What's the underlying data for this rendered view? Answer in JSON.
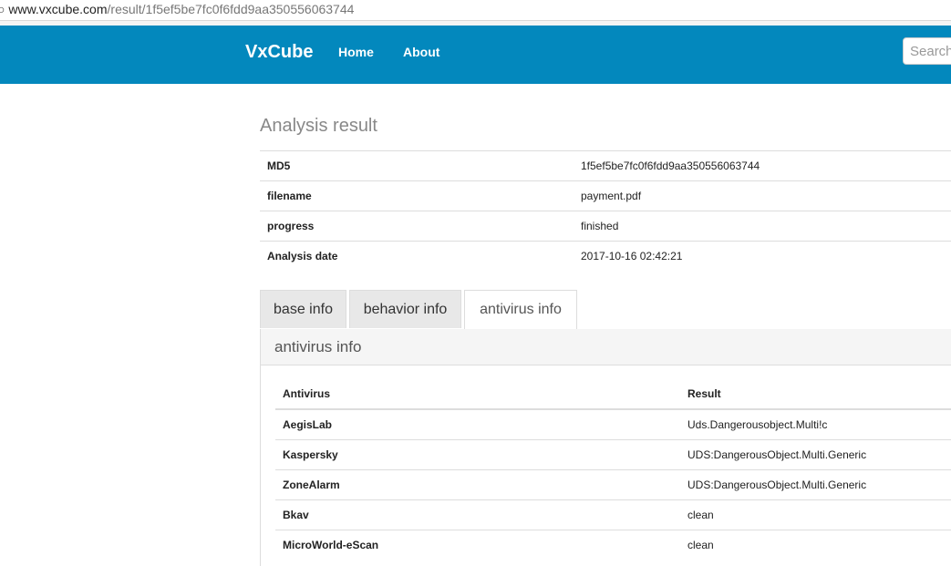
{
  "browser": {
    "url_lead": "○",
    "url_host": " www.vxcube.com",
    "url_path": "/result/1f5ef5be7fc0f6fdd9aa350556063744"
  },
  "navbar": {
    "brand": "VxCube",
    "home": "Home",
    "about": "About",
    "search_placeholder": "Search",
    "color": "#0388bd"
  },
  "page": {
    "title": "Analysis result"
  },
  "info": [
    {
      "key": "MD5",
      "value": "1f5ef5be7fc0f6fdd9aa350556063744"
    },
    {
      "key": "filename",
      "value": "payment.pdf"
    },
    {
      "key": "progress",
      "value": "finished"
    },
    {
      "key": "Analysis date",
      "value": "2017-10-16 02:42:21"
    }
  ],
  "tabs": {
    "base": "base info",
    "behavior": "behavior info",
    "antivirus": "antivirus info",
    "active": "antivirus info"
  },
  "panel": {
    "heading": "antivirus info",
    "columns": [
      "Antivirus",
      "Result"
    ],
    "rows": [
      {
        "antivirus": "AegisLab",
        "result": "Uds.Dangerousobject.Multi!c"
      },
      {
        "antivirus": "Kaspersky",
        "result": "UDS:DangerousObject.Multi.Generic"
      },
      {
        "antivirus": "ZoneAlarm",
        "result": "UDS:DangerousObject.Multi.Generic"
      },
      {
        "antivirus": "Bkav",
        "result": "clean"
      },
      {
        "antivirus": "MicroWorld-eScan",
        "result": "clean"
      }
    ]
  }
}
